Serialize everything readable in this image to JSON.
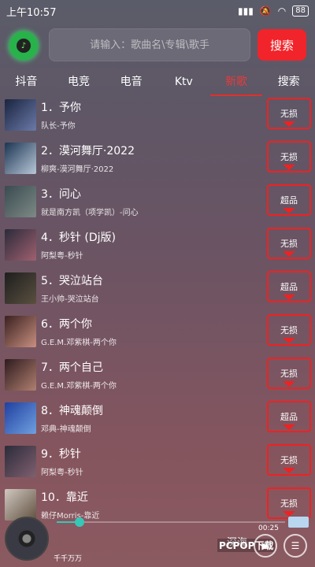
{
  "status": {
    "time": "上午10:57",
    "battery": "88"
  },
  "search": {
    "placeholder": "请输入：歌曲名\\专辑\\歌手",
    "button": "搜索"
  },
  "tabs": [
    "抖音",
    "电竞",
    "电音",
    "Ktv",
    "新歌",
    "搜索"
  ],
  "active_tab": 4,
  "songs": [
    {
      "title": "1．予你",
      "artist": "队长-予你",
      "quality": "无损",
      "thumb_colors": [
        "#1a2440",
        "#6b7aa8"
      ]
    },
    {
      "title": "2．漠河舞厅·2022",
      "artist": "柳爽-漠河舞厅·2022",
      "quality": "无损",
      "thumb_colors": [
        "#1c3452",
        "#b8c8d8"
      ]
    },
    {
      "title": "3．问心",
      "artist": "就是南方凯（项学凯）-问心",
      "quality": "超品",
      "thumb_colors": [
        "#3a4a50",
        "#7d8a86"
      ]
    },
    {
      "title": "4．秒针 (Dj版)",
      "artist": "阿梨粤-秒针",
      "quality": "无损",
      "thumb_colors": [
        "#2b2b3a",
        "#a06070"
      ]
    },
    {
      "title": "5．哭泣站台",
      "artist": "王小帅-哭泣站台",
      "quality": "超品",
      "thumb_colors": [
        "#1e1e1e",
        "#5a5040"
      ]
    },
    {
      "title": "6．两个你",
      "artist": "G.E.M.邓紫棋-两个你",
      "quality": "无损",
      "thumb_colors": [
        "#3a2020",
        "#c89080"
      ]
    },
    {
      "title": "7．两个自己",
      "artist": "G.E.M.邓紫棋-两个你",
      "quality": "无损",
      "thumb_colors": [
        "#2e1a1e",
        "#b08070"
      ]
    },
    {
      "title": "8．神魂颠倒",
      "artist": "邓典-神魂颠倒",
      "quality": "超品",
      "thumb_colors": [
        "#2040a0",
        "#70a0e0"
      ]
    },
    {
      "title": "9．秒针",
      "artist": "阿梨粤-秒针",
      "quality": "无损",
      "thumb_colors": [
        "#2b2b3a",
        "#806070"
      ]
    },
    {
      "title": "10．靠近",
      "artist": "赖仔Morris-靠近",
      "quality": "无损",
      "thumb_colors": [
        "#d0c8c0",
        "#605040"
      ]
    }
  ],
  "player": {
    "title": "千千万万",
    "artist": "深海",
    "time": "00:25",
    "progress": 0.1,
    "watermark": "PCPOP下载"
  }
}
